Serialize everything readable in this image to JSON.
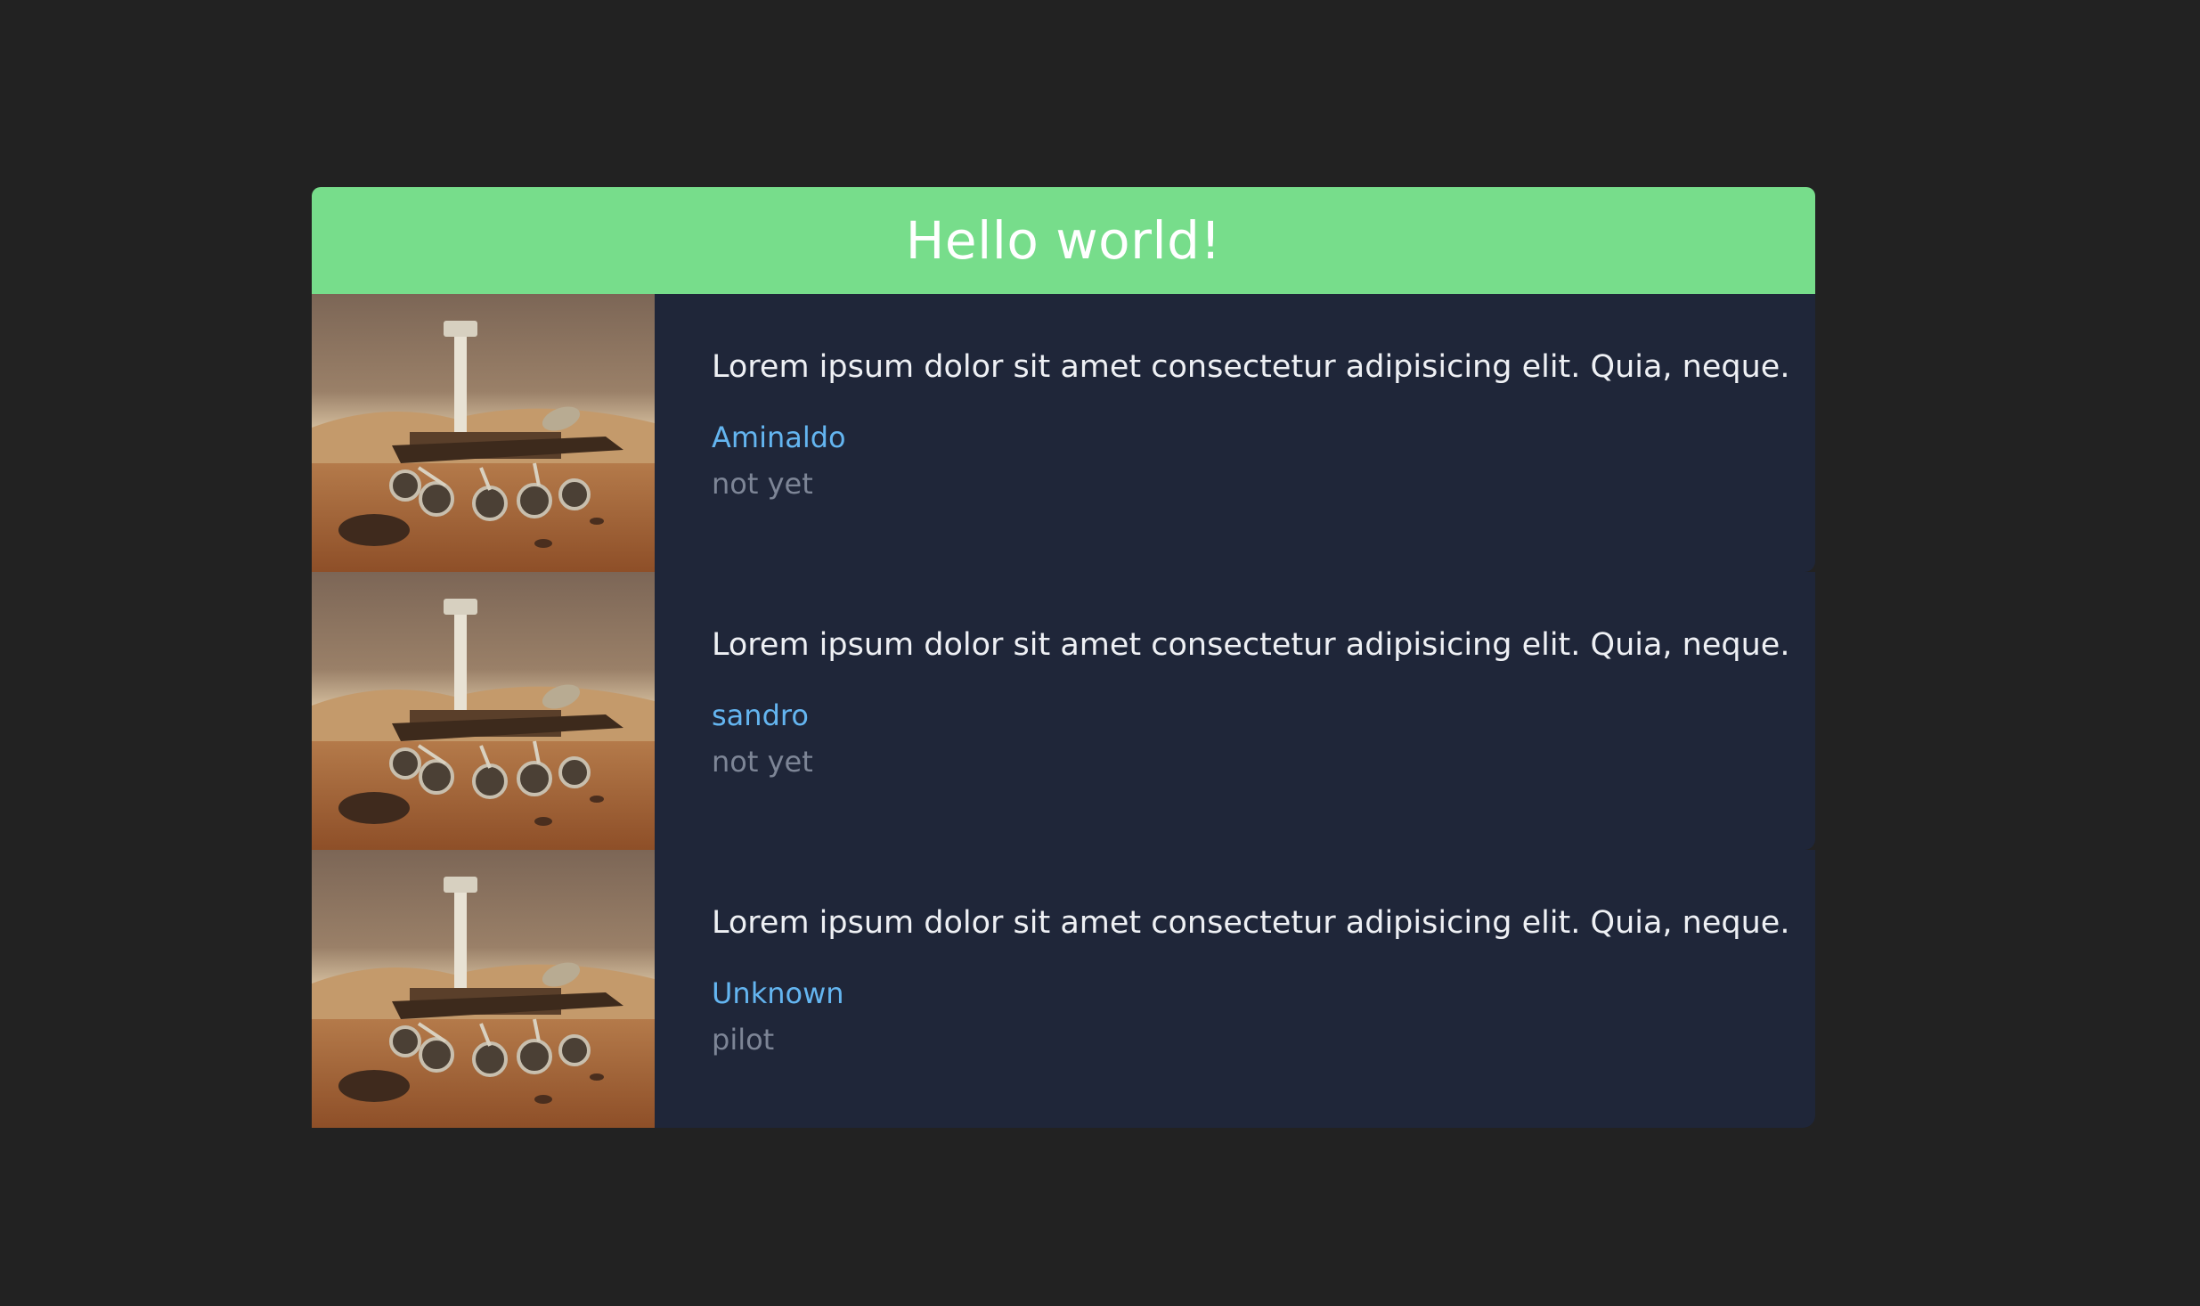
{
  "header": {
    "title": "Hello world!"
  },
  "cards": [
    {
      "image": "mars-rover-image",
      "text": "Lorem ipsum dolor sit amet consectetur adipisicing elit. Quia, neque.",
      "author": "Aminaldo",
      "status": "not yet"
    },
    {
      "image": "mars-rover-image",
      "text": "Lorem ipsum dolor sit amet consectetur adipisicing elit. Quia, neque.",
      "author": "sandro",
      "status": "not yet"
    },
    {
      "image": "mars-rover-image",
      "text": "Lorem ipsum dolor sit amet consectetur adipisicing elit. Quia, neque.",
      "author": "Unknown",
      "status": "pilot"
    }
  ],
  "colors": {
    "background": "#222222",
    "header": "#77dd8b",
    "card": "#1f2639",
    "author": "#64b5f0",
    "status": "#7d8596"
  }
}
